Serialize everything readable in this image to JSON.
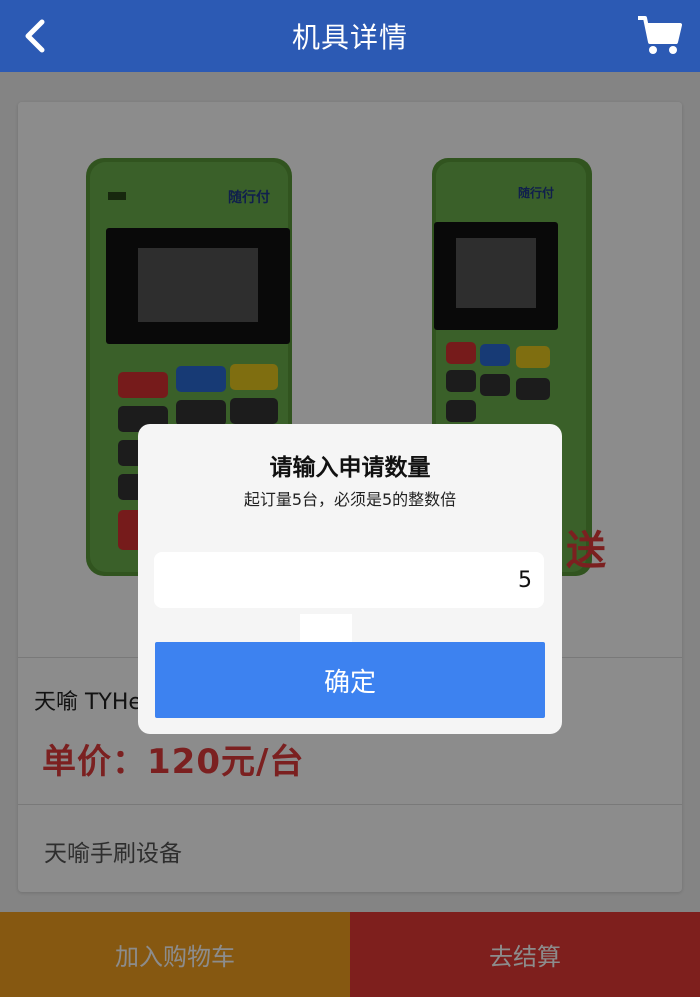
{
  "header": {
    "title": "机具详情",
    "back_icon": "chevron-left-icon",
    "cart_icon": "shopping-cart-icon"
  },
  "product": {
    "name": "天喻 TYHe",
    "price": "单价：120元/台",
    "description": "天喻手刷设备",
    "image_brand_text": "随行付",
    "image_stamp_text": "送"
  },
  "dialog": {
    "title": "请输入申请数量",
    "subtitle": "起订量5台，必须是5的整数倍",
    "quantity_value": "5",
    "confirm_label": "确定"
  },
  "footer": {
    "add_to_cart_label": "加入购物车",
    "checkout_label": "去结算"
  },
  "colors": {
    "header_bg": "#2c5ab4",
    "price_red": "#e03b3b",
    "add_cart_bg": "#f4a020",
    "checkout_bg": "#e53935",
    "confirm_bg": "#3d82f0",
    "device_green": "#6ab04c"
  }
}
